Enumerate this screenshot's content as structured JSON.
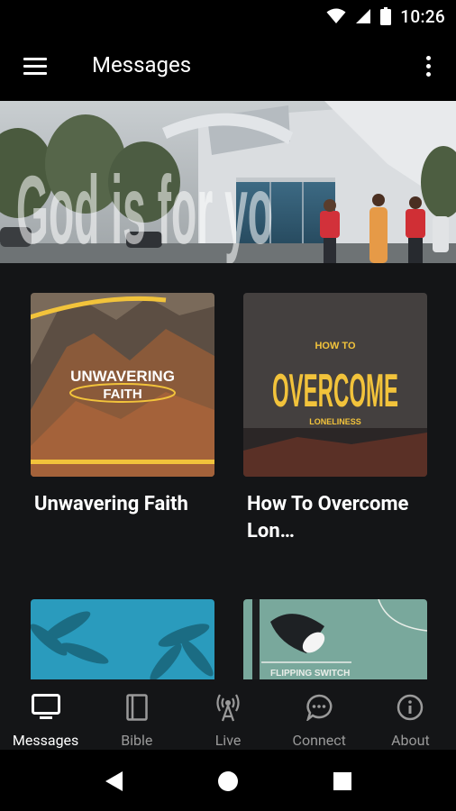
{
  "status_bar": {
    "time": "10:26",
    "icons": [
      "wifi-icon",
      "signal-icon",
      "battery-icon"
    ]
  },
  "app_bar": {
    "title": "Messages",
    "menu_icon": "hamburger-menu-icon",
    "overflow_icon": "more-vert-icon"
  },
  "hero": {
    "overlay_text": "God is for yo",
    "description_icon": "church-building-banner"
  },
  "cards": [
    {
      "title": "Unwavering Faith",
      "art_text_main": "UNWAVERING",
      "art_text_sub": "FAITH"
    },
    {
      "title": "How To Overcome Lon…",
      "art_text_top": "HOW TO",
      "art_text_main": "OVERCOME",
      "art_text_sub": "LONELINESS"
    },
    {
      "title": ""
    },
    {
      "title": "",
      "art_text": "FLIPPING    SWITCH"
    }
  ],
  "bottom_nav": {
    "active": "Messages",
    "items": [
      {
        "label": "Messages",
        "icon": "tv-icon"
      },
      {
        "label": "Bible",
        "icon": "book-icon"
      },
      {
        "label": "Live",
        "icon": "broadcast-icon"
      },
      {
        "label": "Connect",
        "icon": "chat-bubble-icon"
      },
      {
        "label": "About",
        "icon": "info-icon"
      }
    ]
  },
  "system_nav": {
    "back": "back-icon",
    "home": "home-icon",
    "recents": "recents-icon"
  },
  "colors": {
    "background": "#141517",
    "accent_yellow": "#f2c33b",
    "text_inactive": "#9a9a9a"
  }
}
